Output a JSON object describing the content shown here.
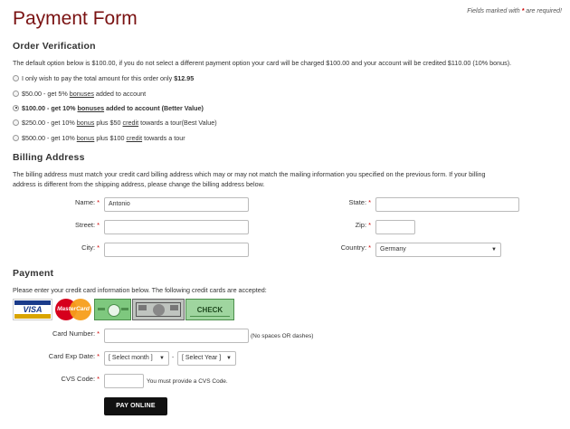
{
  "header": {
    "title": "Payment Form",
    "required_note_prefix": "Fields marked with",
    "required_star": "*",
    "required_note_suffix": "are required!"
  },
  "order": {
    "heading": "Order Verification",
    "intro": "The default option below is $100.00, if you do not select a different payment option your card will be charged $100.00 and your account will be credited $110.00 (10% bonus).",
    "options": [
      {
        "parts": [
          "I only wish to pay the total amount for this order only ",
          "$12.95"
        ],
        "checked": false
      },
      {
        "parts": [
          "$50.00 - get 5% ",
          "bonuses",
          " added to account"
        ],
        "checked": false
      },
      {
        "parts": [
          "$100.00 - get 10% ",
          "bonuses",
          " added to account (Better Value)"
        ],
        "checked": true
      },
      {
        "parts": [
          "$250.00 - get 10% ",
          "bonus",
          " plus $50 ",
          "credit",
          " towards a tour(Best Value)"
        ],
        "checked": false
      },
      {
        "parts": [
          "$500.00 - get 10% ",
          "bonus",
          " plus $100 ",
          "credit",
          " towards a tour"
        ],
        "checked": false
      }
    ]
  },
  "billing": {
    "heading": "Billing Address",
    "intro_line1": "The billing address must match your credit card billing address which may or may not match the mailing information you specified on the previous form. If your billing",
    "intro_line2": "address is different from the shipping address, please change the billing address below.",
    "name_label": "Name:",
    "name_value": "Antonio",
    "street_label": "Street:",
    "city_label": "City:",
    "state_label": "State:",
    "zip_label": "Zip:",
    "country_label": "Country:",
    "country_value": "Germany",
    "star": "*"
  },
  "payment": {
    "heading": "Payment",
    "intro": "Please enter your credit card information below. The following credit cards are accepted:",
    "cards": {
      "visa": "VISA",
      "mastercard": "MasterCard",
      "check": "CHECK"
    },
    "card_number_label": "Card Number:",
    "card_number_hint": "(No spaces OR dashes)",
    "exp_label": "Card Exp Date:",
    "exp_month": "[ Select month ]",
    "exp_dash": "-",
    "exp_year": "[ Select Year ]",
    "cvs_label": "CVS Code:",
    "cvs_hint": "You must provide a CVS Code.",
    "submit_label": "PAY ONLINE",
    "star": "*"
  }
}
